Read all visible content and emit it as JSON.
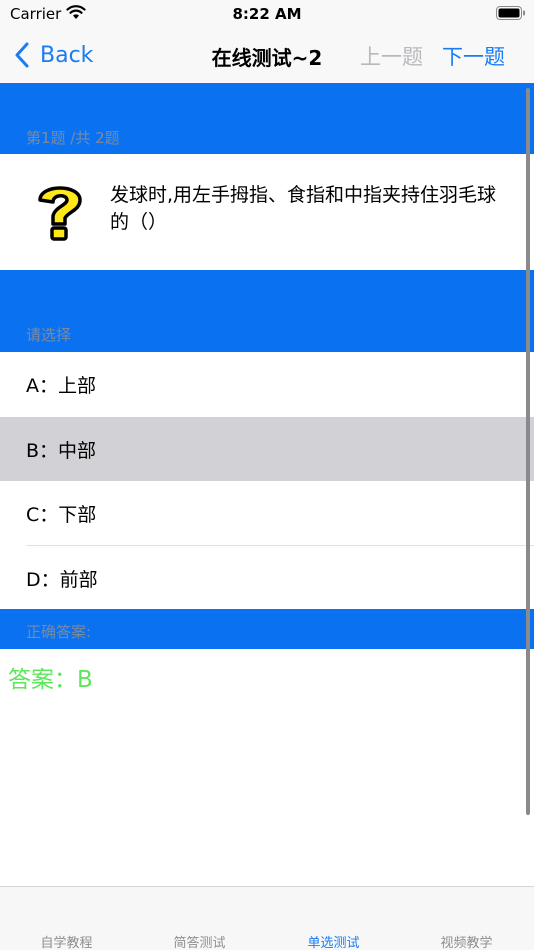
{
  "status_bar": {
    "carrier": "Carrier",
    "time": "8:22 AM",
    "icons": [
      "wifi-icon",
      "battery-icon"
    ]
  },
  "nav": {
    "back_label": "Back",
    "title": "在线测试~2",
    "prev_label": "上一题",
    "next_label": "下一题",
    "prev_enabled": false
  },
  "question": {
    "counter": "第1题 /共 2题",
    "text": "发球时,用左手拇指、食指和中指夹持住羽毛球的（）",
    "icon": "question-mark-icon"
  },
  "choose_header": "请选择",
  "options": [
    {
      "label": "A：上部",
      "selected": false
    },
    {
      "label": "B：中部",
      "selected": true
    },
    {
      "label": "C：下部",
      "selected": false
    },
    {
      "label": "D：前部",
      "selected": false
    }
  ],
  "answer_header": "正确答案:",
  "answer_text": "答案：B",
  "tabs": [
    {
      "label": "自学教程",
      "active": false
    },
    {
      "label": "简答测试",
      "active": false
    },
    {
      "label": "单选测试",
      "active": true
    },
    {
      "label": "视频教学",
      "active": false
    }
  ],
  "colors": {
    "accent": "#1a7cf5",
    "band": "#0a72f1",
    "selected_row": "#d1d1d6",
    "answer": "#5ce65c"
  }
}
